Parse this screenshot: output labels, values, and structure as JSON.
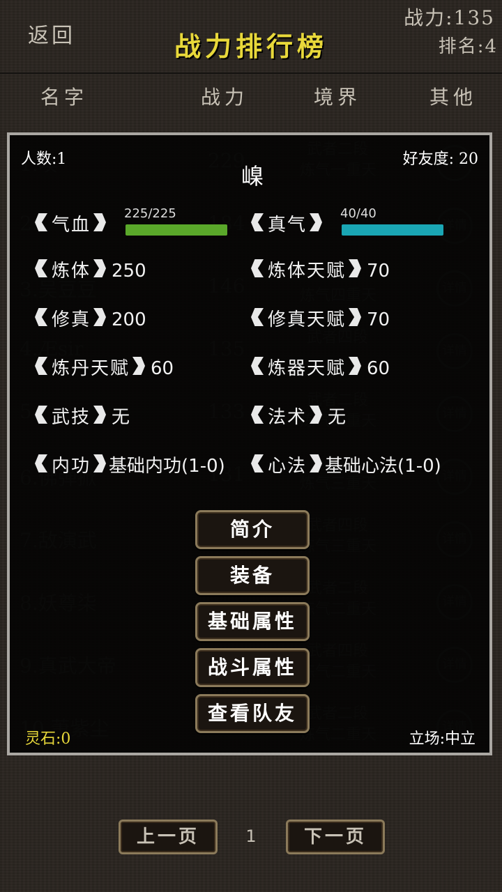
{
  "header": {
    "back_label": "返回",
    "title": "战力排行榜",
    "power": "战力:135",
    "rank": "排名:4"
  },
  "columns": [
    "名字",
    "战力",
    "境界",
    "其他"
  ],
  "ranking_rows": [
    {
      "name": "1.嗅",
      "power": "229",
      "realm1": "武者二段",
      "realm2": "炼气一重天",
      "other": "详情"
    },
    {
      "name": "2.",
      "power": "184",
      "realm1": "",
      "realm2": "",
      "other": "详情"
    },
    {
      "name": "3.吴豆豆",
      "power": "146",
      "realm1": "",
      "realm2": "炼气四重天",
      "other": "详情"
    },
    {
      "name": "4.Æsir",
      "power": "135",
      "realm1": "武者四段",
      "realm2": "",
      "other": "详情"
    },
    {
      "name": "5.",
      "power": "133",
      "realm1": "武者二段",
      "realm2": "炼气二重天",
      "other": "详情"
    },
    {
      "name": "6.佛弹掀",
      "power": "131",
      "realm1": "",
      "realm2": "炼气三重天",
      "other": "详情"
    },
    {
      "name": "7.敌演武",
      "power": "",
      "realm1": "武者四段",
      "realm2": "炼气三重天",
      "other": "详情"
    },
    {
      "name": "8.妖尊柒",
      "power": "",
      "realm1": "武者二段",
      "realm2": "炼气二重天",
      "other": "详情"
    },
    {
      "name": "9.真武大帝",
      "power": "",
      "realm1": "武者四段",
      "realm2": "炼气二重天",
      "other": "详情"
    },
    {
      "name": "10.萧紫尘",
      "power": "",
      "realm1": "武者二段",
      "realm2": "炼气二重天",
      "other": "详情"
    }
  ],
  "player": {
    "count": "人数:1",
    "friendship": "好友度: 20",
    "name": "嵲",
    "hp": {
      "label": "气血",
      "value": "225/225",
      "fraction": 1.0,
      "color": "#5aa82a"
    },
    "qi": {
      "label": "真气",
      "value": "40/40",
      "fraction": 1.0,
      "color": "#1aa6b4"
    },
    "attrs": {
      "body": {
        "label": "炼体",
        "value": "250"
      },
      "body_talent": {
        "label": "炼体天赋",
        "value": "70"
      },
      "cult": {
        "label": "修真",
        "value": "200"
      },
      "cult_talent": {
        "label": "修真天赋",
        "value": "70"
      },
      "alchemy_talent": {
        "label": "炼丹天赋",
        "value": "60"
      },
      "forge_talent": {
        "label": "炼器天赋",
        "value": "60"
      },
      "martial": {
        "label": "武技",
        "value": "无"
      },
      "spell": {
        "label": "法术",
        "value": "无"
      },
      "inner": {
        "label": "内功",
        "value": "基础内功(1-0)"
      },
      "mind": {
        "label": "心法",
        "value": "基础心法(1-0)"
      }
    },
    "spirit_stone": "灵石:0",
    "stance": "立场:中立"
  },
  "buttons": {
    "intro": "简介",
    "equip": "装备",
    "base_attr": "基础属性",
    "battle_attr": "战斗属性",
    "teammates": "查看队友"
  },
  "pagination": {
    "prev": "上一页",
    "page": "1",
    "next": "下一页"
  }
}
